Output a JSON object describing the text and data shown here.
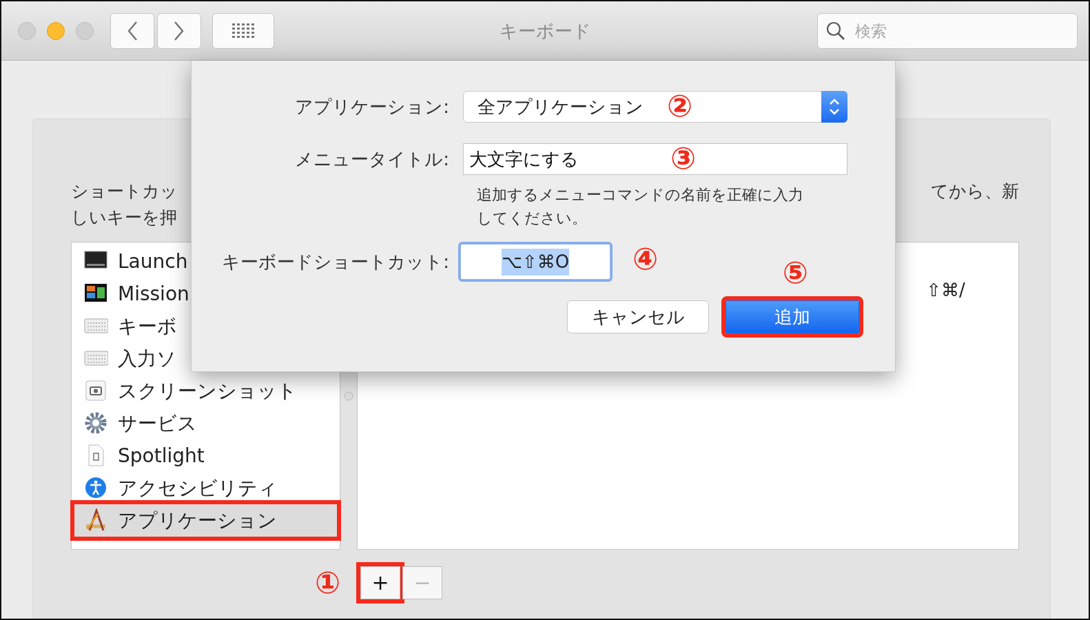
{
  "window": {
    "title": "キーボード",
    "search": {
      "placeholder": "検索"
    }
  },
  "description": {
    "left_lines": [
      "ショートカッ",
      "しいキーを押"
    ],
    "right_line": "てから、新"
  },
  "list": {
    "items": [
      {
        "label": "Launch",
        "selected": false,
        "highlighted": false
      },
      {
        "label": "Mission",
        "selected": false,
        "highlighted": false
      },
      {
        "label": "キーボ",
        "selected": false,
        "highlighted": false
      },
      {
        "label": "入力ソ",
        "selected": false,
        "highlighted": false
      },
      {
        "label": "スクリーンショット",
        "selected": false,
        "highlighted": false
      },
      {
        "label": "サービス",
        "selected": false,
        "highlighted": false
      },
      {
        "label": "Spotlight",
        "selected": false,
        "highlighted": false
      },
      {
        "label": "アクセシビリティ",
        "selected": false,
        "highlighted": false
      },
      {
        "label": "アプリケーション",
        "selected": true,
        "highlighted": true
      }
    ]
  },
  "shortcut_table": {
    "rows": [
      {
        "keys": "⇧⌘/"
      }
    ]
  },
  "buttons": [
    {
      "label": "+",
      "disabled": false,
      "highlighted": true,
      "marker": "①"
    },
    {
      "label": "−",
      "disabled": true,
      "highlighted": false
    }
  ],
  "sheet": {
    "fields": [
      {
        "kind": "popup",
        "label": "アプリケーション:",
        "value": "全アプリケーション",
        "marker": "②"
      },
      {
        "kind": "text",
        "label": "メニュータイトル:",
        "value": "大文字にする",
        "marker": "③",
        "hint": "追加するメニューコマンドの名前を正確に入力してください。"
      },
      {
        "kind": "shortcut",
        "label": "キーボードショートカット:",
        "value": "⌥⇧⌘O",
        "marker": "④"
      }
    ],
    "buttons": [
      {
        "label": "キャンセル",
        "default": false,
        "highlighted": false
      },
      {
        "label": "追加",
        "default": true,
        "highlighted": true,
        "marker": "⑤"
      }
    ]
  }
}
